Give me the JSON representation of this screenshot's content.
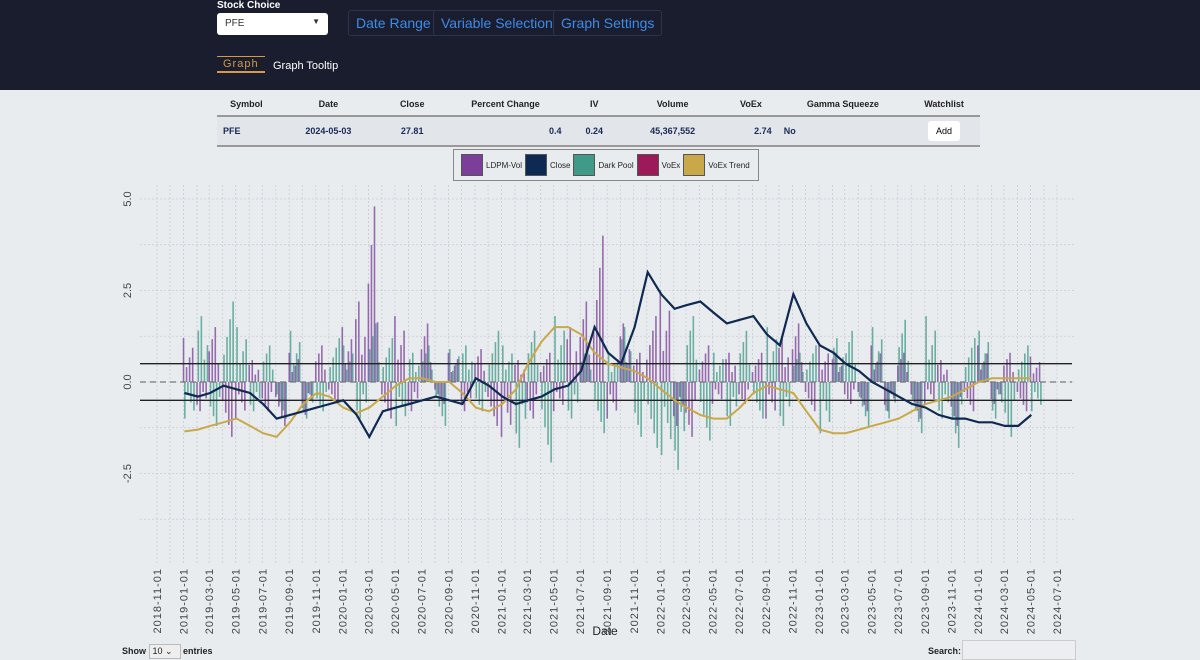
{
  "header": {
    "stock_label": "Stock Choice",
    "stock_value": "PFE",
    "buttons": [
      "Date Range",
      "Variable Selection",
      "Graph Settings"
    ],
    "tabs": [
      "Graph",
      "Graph Tooltip"
    ],
    "active_tab": "Graph"
  },
  "table": {
    "columns": [
      "Symbol",
      "Date",
      "Close",
      "Percent Change",
      "IV",
      "Volume",
      "VoEx",
      "Gamma Squeeze",
      "Watchlist"
    ],
    "row": [
      "PFE",
      "2024-05-03",
      "27.81",
      "0.4",
      "0.24",
      "45,367,552",
      "2.74",
      "No"
    ],
    "add_label": "Add"
  },
  "legend": [
    {
      "name": "LDPM-Vol",
      "color": "#7b3f99"
    },
    {
      "name": "Close",
      "color": "#0f2a52"
    },
    {
      "name": "Dark Pool",
      "color": "#3f9a88"
    },
    {
      "name": "VoEx",
      "color": "#9c1a5a"
    },
    {
      "name": "VoEx Trend",
      "color": "#c9a84a"
    }
  ],
  "chart_data": {
    "type": "line",
    "xlabel": "Date",
    "ylabel": "",
    "ylim": [
      -4.5,
      5.4
    ],
    "yticks": [
      -2.5,
      0.0,
      2.5,
      5.0
    ],
    "xticks": [
      "2018-11-01",
      "2019-01-01",
      "2019-03-01",
      "2019-05-01",
      "2019-07-01",
      "2019-09-01",
      "2019-11-01",
      "2020-01-01",
      "2020-03-01",
      "2020-05-01",
      "2020-07-01",
      "2020-09-01",
      "2020-11-01",
      "2021-01-01",
      "2021-03-01",
      "2021-05-01",
      "2021-07-01",
      "2021-09-01",
      "2021-11-01",
      "2022-01-01",
      "2022-03-01",
      "2022-05-01",
      "2022-07-01",
      "2022-09-01",
      "2022-11-01",
      "2023-01-01",
      "2023-03-01",
      "2023-05-01",
      "2023-07-01",
      "2023-09-01",
      "2023-11-01",
      "2024-01-01",
      "2024-03-01",
      "2024-05-01",
      "2024-07-01"
    ],
    "grid": true,
    "hlines": {
      "solid": [
        0.5,
        -0.5
      ],
      "dashed": [
        0
      ]
    },
    "start_month": "2019-01",
    "ldpm_vol": [
      1.2,
      -0.8,
      1.5,
      -1.5,
      -1.0,
      0.6,
      -0.8,
      -1.2,
      0.8,
      -0.9,
      1.0,
      -0.6,
      1.5,
      2.2,
      4.8,
      -1.0,
      1.8,
      -0.8,
      1.6,
      -0.6,
      0.8,
      -0.8,
      0.9,
      -1.2,
      -1.5,
      0.6,
      -1.0,
      0.8,
      -0.8,
      1.5,
      2.2,
      4.0,
      -1.0,
      1.6,
      0.8,
      1.8,
      2.5,
      -1.2,
      -1.5,
      1.0,
      -0.6,
      0.8,
      -0.6,
      0.8,
      -1.0,
      1.2,
      1.6,
      -0.8,
      1.0,
      0.8,
      -0.6,
      -0.8,
      1.0,
      -0.8,
      0.8,
      -1.0,
      -0.6,
      0.6,
      -1.2,
      -0.8,
      1.0,
      -0.6,
      0.8,
      -0.8,
      0.7
    ],
    "dark_pool": [
      -1.0,
      1.8,
      -1.2,
      2.2,
      1.5,
      -0.8,
      1.0,
      -1.0,
      1.4,
      -1.0,
      -0.8,
      1.2,
      1.0,
      -1.0,
      1.6,
      1.2,
      -1.2,
      0.8,
      1.0,
      -1.2,
      0.9,
      1.0,
      -0.8,
      1.4,
      1.0,
      -1.8,
      1.4,
      -2.2,
      1.8,
      -1.0,
      1.0,
      -1.4,
      0.8,
      1.5,
      -1.5,
      -1.8,
      -2.0,
      -2.4,
      1.8,
      -1.6,
      0.8,
      -1.2,
      1.4,
      -1.0,
      1.5,
      -1.2,
      0.8,
      1.0,
      -1.4,
      1.2,
      1.4,
      -1.2,
      1.5,
      -1.0,
      1.7,
      -1.4,
      1.8,
      -1.0,
      -1.8,
      1.2,
      1.4,
      -1.0,
      -1.5,
      1.0,
      -0.8
    ],
    "close": [
      -0.3,
      -0.4,
      -0.3,
      -0.1,
      -0.2,
      -0.3,
      -0.6,
      -1.0,
      -0.9,
      -0.8,
      -0.7,
      -0.6,
      -0.5,
      -0.9,
      -1.5,
      -0.8,
      -0.7,
      -0.6,
      -0.5,
      -0.4,
      -0.5,
      -0.6,
      0.1,
      -0.1,
      -0.4,
      -0.6,
      -0.5,
      -0.4,
      -0.2,
      -0.1,
      0.3,
      1.5,
      0.8,
      0.5,
      1.5,
      3.0,
      2.4,
      2.0,
      2.1,
      2.2,
      1.9,
      1.6,
      1.7,
      1.8,
      1.3,
      1.0,
      2.4,
      1.6,
      1.0,
      0.8,
      0.5,
      0.3,
      0.0,
      -0.2,
      -0.4,
      -0.6,
      -0.7,
      -0.9,
      -1.0,
      -1.0,
      -1.1,
      -1.1,
      -1.2,
      -1.2,
      -0.9
    ],
    "voex_trend": [
      -1.35,
      -1.3,
      -1.2,
      -1.1,
      -1.0,
      -1.2,
      -1.4,
      -1.5,
      -1.1,
      -0.6,
      -0.3,
      -0.4,
      -0.7,
      -0.85,
      -0.7,
      -0.4,
      -0.1,
      0.1,
      0.1,
      0.0,
      0.0,
      -0.3,
      -0.7,
      -0.8,
      -0.6,
      -0.2,
      0.5,
      1.1,
      1.5,
      1.5,
      1.3,
      0.8,
      0.5,
      0.4,
      0.3,
      0.1,
      -0.2,
      -0.5,
      -0.7,
      -0.9,
      -1.0,
      -1.0,
      -0.7,
      -0.3,
      -0.1,
      -0.2,
      -0.3,
      -0.8,
      -1.3,
      -1.4,
      -1.4,
      -1.3,
      -1.2,
      -1.1,
      -1.0,
      -0.8,
      -0.6,
      -0.5,
      -0.4,
      -0.2,
      0.0,
      0.1,
      0.1,
      0.1,
      0.1
    ]
  },
  "footer": {
    "show": "Show",
    "entries_value": "10",
    "entries": "entries",
    "search": "Search:"
  }
}
